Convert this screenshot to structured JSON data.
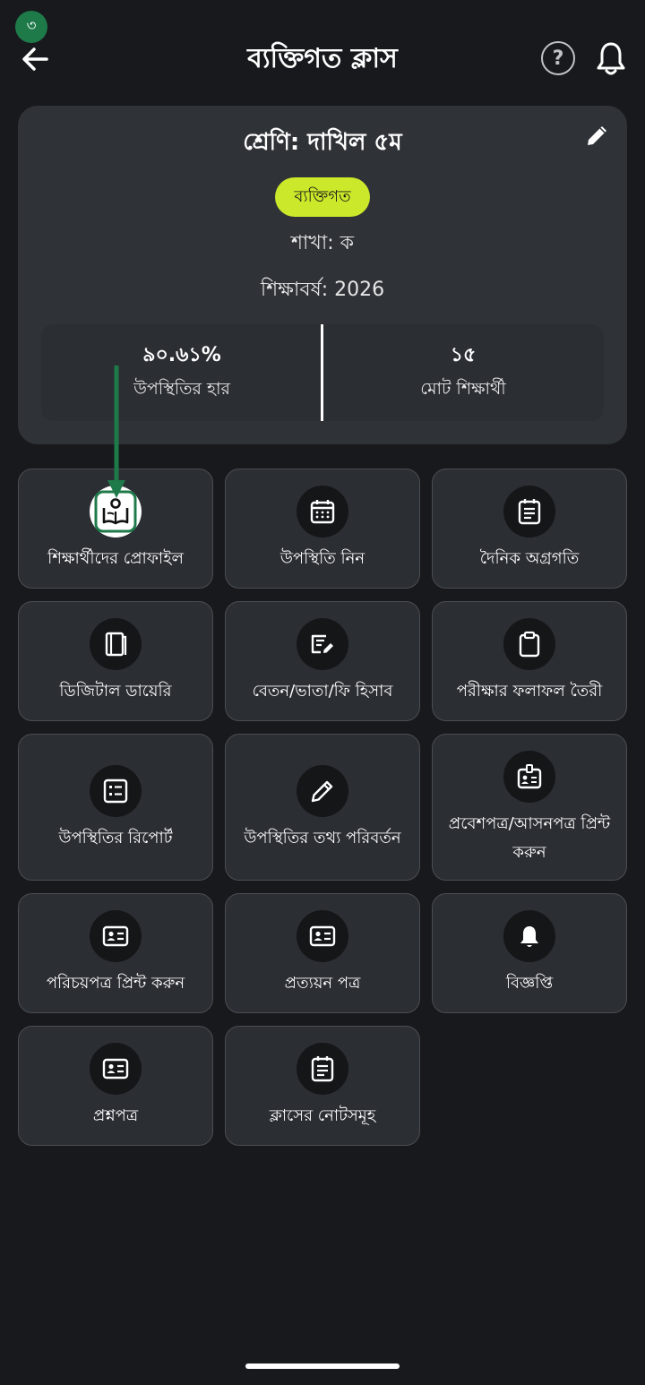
{
  "header": {
    "badge": "৩",
    "title": "ব্যক্তিগত ক্লাস",
    "help_label": "?"
  },
  "card": {
    "class_name": "শ্রেণি: দাখিল ৫ম",
    "type": "ব্যক্তিগত",
    "section": "শাখা: ক",
    "year": "শিক্ষাবর্ষ: 2026",
    "attendance_value": "৯০.৬১%",
    "attendance_label": "উপস্থিতির হার",
    "students_value": "১৫",
    "students_label": "মোট শিক্ষার্থী"
  },
  "tiles": [
    {
      "label": "শিক্ষার্থীদের প্রোফাইল",
      "icon": "student-profile-icon"
    },
    {
      "label": "উপস্থিতি নিন",
      "icon": "calendar-icon"
    },
    {
      "label": "দৈনিক অগ্রগতি",
      "icon": "daily-progress-icon"
    },
    {
      "label": "ডিজিটাল ডায়েরি",
      "icon": "diary-icon"
    },
    {
      "label": "বেতন/ভাতা/ফি হিসাব",
      "icon": "fee-edit-icon"
    },
    {
      "label": "পরীক্ষার ফলাফল তৈরী",
      "icon": "clipboard-icon"
    },
    {
      "label": "উপস্থিতির রিপোর্ট",
      "icon": "report-list-icon"
    },
    {
      "label": "উপস্থিতির তথ্য পরিবর্তন",
      "icon": "pencil-icon"
    },
    {
      "label": "প্রবেশপত্র/আসনপত্র প্রিন্ট করুন",
      "icon": "admit-card-icon"
    },
    {
      "label": "পরিচয়পত্র প্রিন্ট করুন",
      "icon": "id-card-icon"
    },
    {
      "label": "প্রত্যয়ন পত্র",
      "icon": "certificate-icon"
    },
    {
      "label": "বিজ্ঞপ্তি",
      "icon": "bell-icon"
    },
    {
      "label": "প্রশ্নপত্র",
      "icon": "question-paper-icon"
    },
    {
      "label": "ক্লাসের নোটসমূহ",
      "icon": "notes-icon"
    }
  ],
  "colors": {
    "background": "#17191c",
    "card": "#2f3237",
    "accent": "#cbe82a",
    "badge": "#1f7a4a",
    "arrow": "#1f7a4a"
  }
}
